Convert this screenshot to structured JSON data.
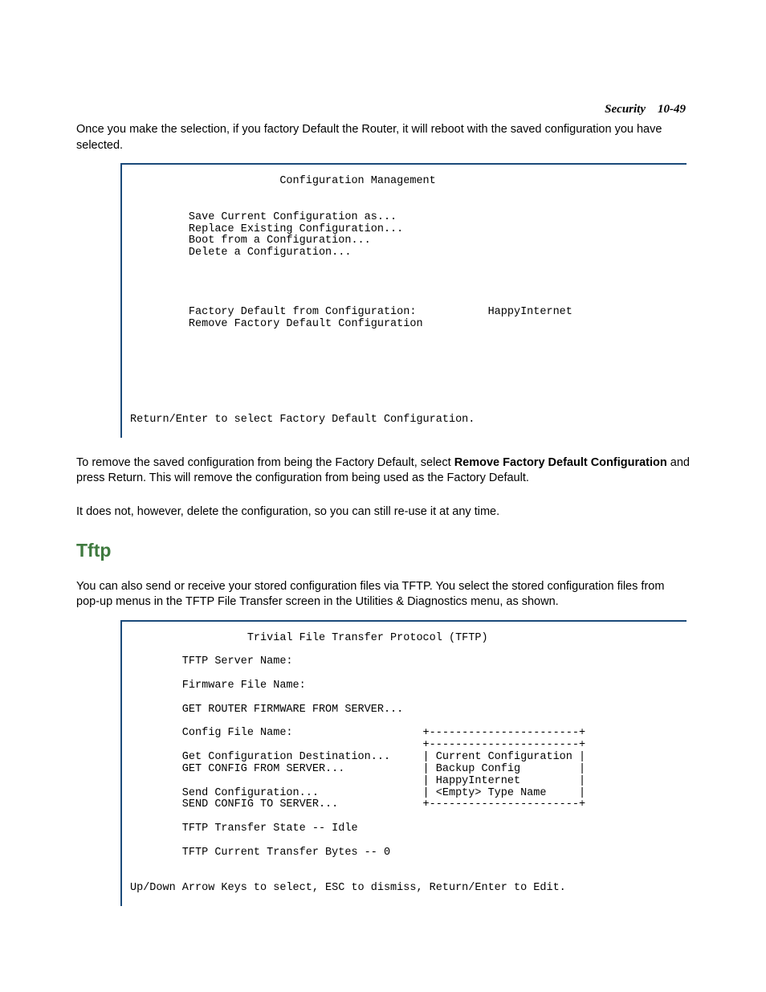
{
  "header": {
    "section": "Security",
    "page": "10-49"
  },
  "para1": "Once you make the selection, if you factory Default the Router, it will reboot with the saved configuration you have selected.",
  "screen1": "                       Configuration Management\n\n\n         Save Current Configuration as...\n         Replace Existing Configuration...\n         Boot from a Configuration...\n         Delete a Configuration...\n\n\n\n\n         Factory Default from Configuration:           HappyInternet\n         Remove Factory Default Configuration\n\n\n\n\n\n\n\nReturn/Enter to select Factory Default Configuration.\n",
  "para2a": "To remove the saved configuration from being the Factory Default, select ",
  "para2bold": "Remove Factory Default Configuration",
  "para2b": " and press Return. This will remove the configuration from being used as the Factory Default.",
  "para3": "It does not, however, delete the configuration, so you can still re-use it at any time.",
  "section_title": "Tftp",
  "para4": "You can also send or receive your stored configuration files via TFTP. You select the stored configuration files from pop-up menus in the TFTP File Transfer screen in the Utilities & Diagnostics menu, as shown.",
  "screen2": "                  Trivial File Transfer Protocol (TFTP)\n\n        TFTP Server Name:\n\n        Firmware File Name:\n\n        GET ROUTER FIRMWARE FROM SERVER...\n\n        Config File Name:                    +-----------------------+\n                                             +-----------------------+\n        Get Configuration Destination...     | Current Configuration |\n        GET CONFIG FROM SERVER...            | Backup Config         |\n                                             | HappyInternet         |\n        Send Configuration...                | <Empty> Type Name     |\n        SEND CONFIG TO SERVER...             +-----------------------+\n\n        TFTP Transfer State -- Idle\n\n        TFTP Current Transfer Bytes -- 0\n\n\nUp/Down Arrow Keys to select, ESC to dismiss, Return/Enter to Edit."
}
